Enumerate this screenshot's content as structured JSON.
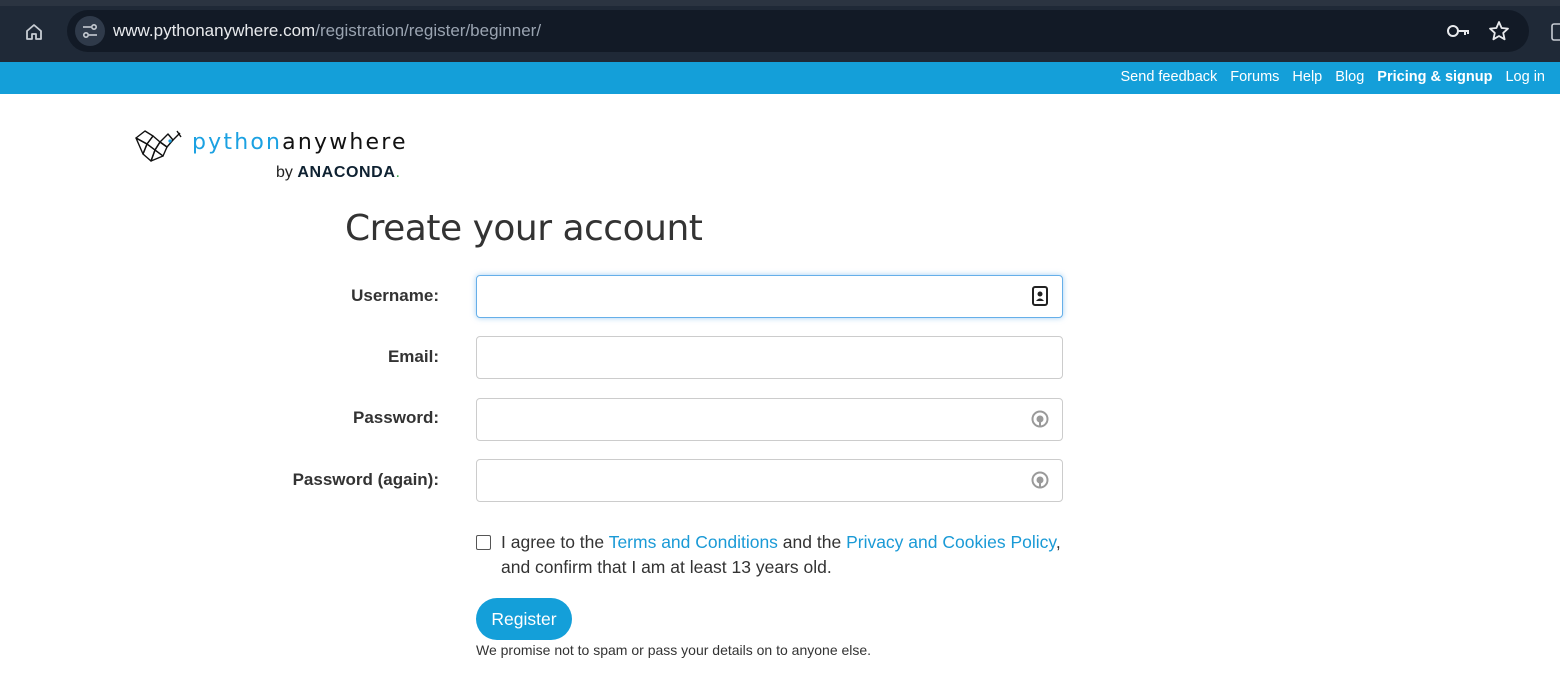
{
  "browser": {
    "url_host": "www.pythonanywhere.com",
    "url_path": "/registration/register/beginner/"
  },
  "topnav": {
    "items": [
      {
        "label": "Send feedback"
      },
      {
        "label": "Forums"
      },
      {
        "label": "Help"
      },
      {
        "label": "Blog"
      },
      {
        "label": "Pricing & signup"
      },
      {
        "label": "Log in"
      }
    ]
  },
  "logo": {
    "word_python": "python",
    "word_anywhere": "anywhere",
    "by": "by",
    "anaconda": "ANACONDA",
    "dot": "."
  },
  "form": {
    "title": "Create your account",
    "username_label": "Username:",
    "username_value": "",
    "email_label": "Email:",
    "email_value": "",
    "password_label": "Password:",
    "password_value": "",
    "password_again_label": "Password (again):",
    "password_again_value": "",
    "terms": {
      "checked": false,
      "prefix": "I agree to the ",
      "terms_link": "Terms and Conditions",
      "middle": " and the ",
      "privacy_link": "Privacy and Cookies Policy",
      "suffix": ", and confirm that I am at least 13 years old."
    },
    "register_label": "Register",
    "promise": "We promise not to spam or pass your details on to anyone else."
  },
  "colors": {
    "brand_blue": "#149fd9",
    "link_blue": "#1a9ad6",
    "browser_dark": "#1f2937"
  }
}
